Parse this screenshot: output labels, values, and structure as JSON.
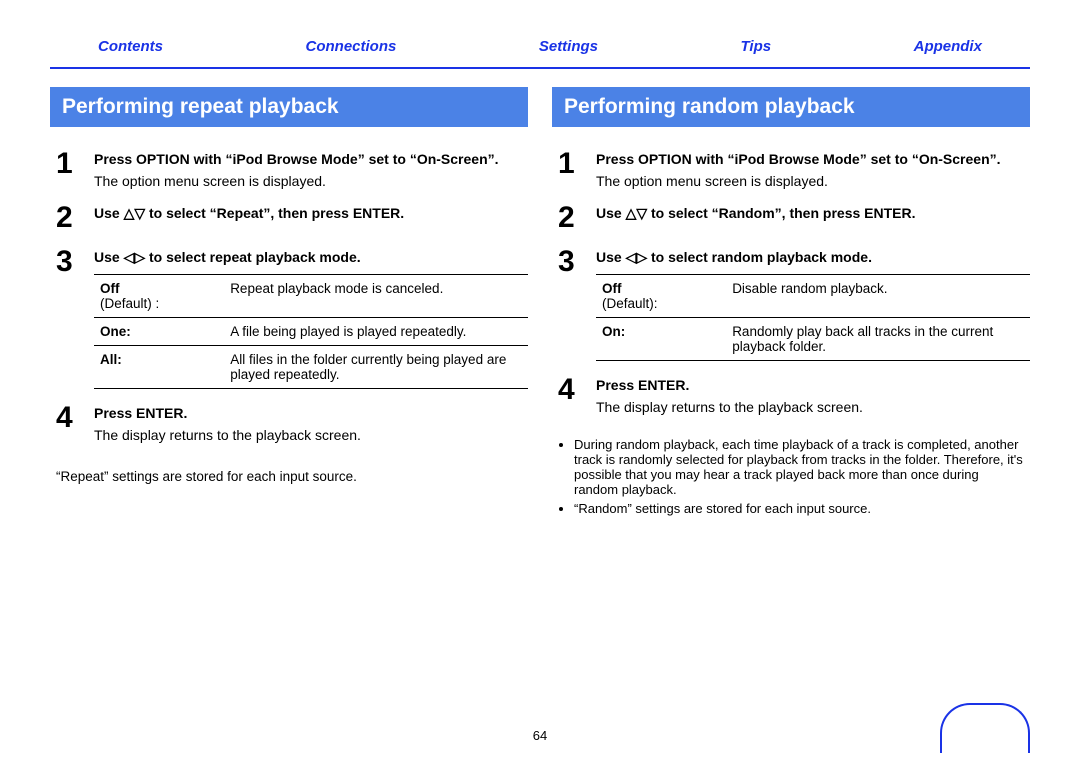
{
  "nav": [
    "Contents",
    "Connections",
    "Settings",
    "Tips",
    "Appendix"
  ],
  "pageNumber": "64",
  "left": {
    "title": "Performing repeat playback",
    "steps": [
      {
        "num": "1",
        "bold": "Press OPTION with “iPod Browse Mode” set to “On-Screen”.",
        "desc": "The option menu screen is displayed."
      },
      {
        "num": "2",
        "bold": "Use △▽ to select “Repeat”, then press ENTER."
      },
      {
        "num": "3",
        "bold": "Use ◁▷ to select repeat playback mode."
      },
      {
        "num": "4",
        "bold": "Press ENTER.",
        "desc": "The display returns to the playback screen."
      }
    ],
    "modes": [
      {
        "label": "Off",
        "sub": "(Default) :",
        "desc": "Repeat playback mode is canceled."
      },
      {
        "label": "One:",
        "desc": "A file being played is played repeatedly."
      },
      {
        "label": "All:",
        "desc": "All files in the folder currently being played are played repeatedly."
      }
    ],
    "footnote": "“Repeat” settings are stored for each input source."
  },
  "right": {
    "title": "Performing random playback",
    "steps": [
      {
        "num": "1",
        "bold": "Press OPTION with “iPod Browse Mode” set to “On-Screen”.",
        "desc": "The option menu screen is displayed."
      },
      {
        "num": "2",
        "bold": "Use △▽ to select “Random”, then press ENTER."
      },
      {
        "num": "3",
        "bold": "Use ◁▷ to select random playback mode."
      },
      {
        "num": "4",
        "bold": "Press ENTER.",
        "desc": "The display returns to the playback screen."
      }
    ],
    "modes": [
      {
        "label": "Off",
        "sub": "(Default):",
        "desc": "Disable random playback."
      },
      {
        "label": "On:",
        "desc": "Randomly play back all tracks in the current playback folder."
      }
    ],
    "notes": [
      "During random playback, each time playback of a track is completed, another track is randomly selected for playback from tracks in the folder. Therefore, it's possible that you may hear a track played back more than once during random playback.",
      "“Random” settings are stored for each input source."
    ]
  }
}
